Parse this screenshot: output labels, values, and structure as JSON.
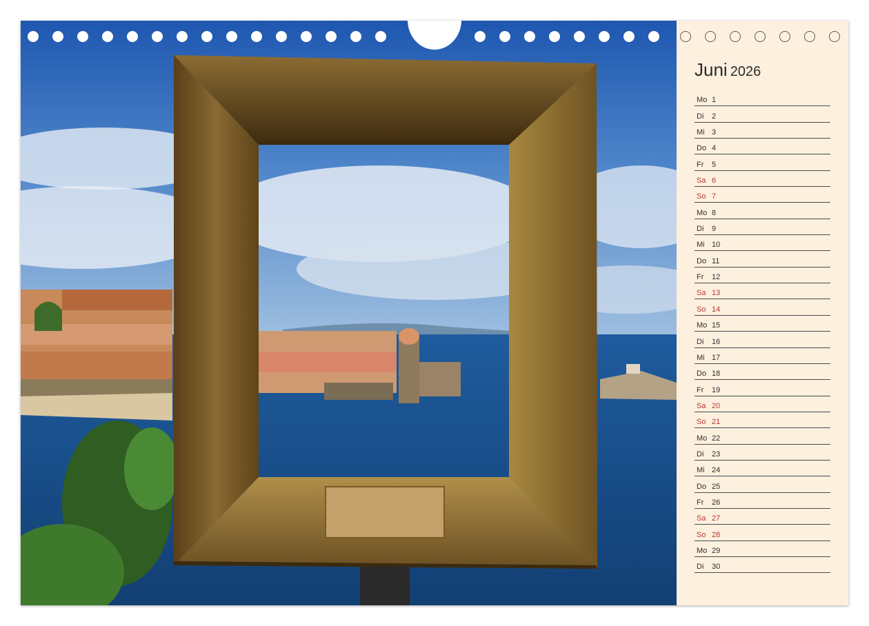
{
  "calendar": {
    "month": "Juni",
    "year": "2026",
    "days": [
      {
        "wd": "Mo",
        "d": "1"
      },
      {
        "wd": "Di",
        "d": "2"
      },
      {
        "wd": "Mi",
        "d": "3"
      },
      {
        "wd": "Do",
        "d": "4"
      },
      {
        "wd": "Fr",
        "d": "5"
      },
      {
        "wd": "Sa",
        "d": "6"
      },
      {
        "wd": "So",
        "d": "7"
      },
      {
        "wd": "Mo",
        "d": "8"
      },
      {
        "wd": "Di",
        "d": "9"
      },
      {
        "wd": "Mi",
        "d": "10"
      },
      {
        "wd": "Do",
        "d": "11"
      },
      {
        "wd": "Fr",
        "d": "12"
      },
      {
        "wd": "Sa",
        "d": "13"
      },
      {
        "wd": "So",
        "d": "14"
      },
      {
        "wd": "Mo",
        "d": "15"
      },
      {
        "wd": "Di",
        "d": "16"
      },
      {
        "wd": "Mi",
        "d": "17"
      },
      {
        "wd": "Do",
        "d": "18"
      },
      {
        "wd": "Fr",
        "d": "19"
      },
      {
        "wd": "Sa",
        "d": "20"
      },
      {
        "wd": "So",
        "d": "21"
      },
      {
        "wd": "Mo",
        "d": "22"
      },
      {
        "wd": "Di",
        "d": "23"
      },
      {
        "wd": "Mi",
        "d": "24"
      },
      {
        "wd": "Do",
        "d": "25"
      },
      {
        "wd": "Fr",
        "d": "26"
      },
      {
        "wd": "Sa",
        "d": "27"
      },
      {
        "wd": "So",
        "d": "28"
      },
      {
        "wd": "Mo",
        "d": "29"
      },
      {
        "wd": "Di",
        "d": "30"
      }
    ]
  },
  "colors": {
    "paper": "#fdf0df",
    "weekend": "#b3392f",
    "sky": "#2a66b8",
    "sea": "#1d5a98",
    "frame": "#7a5a26"
  }
}
